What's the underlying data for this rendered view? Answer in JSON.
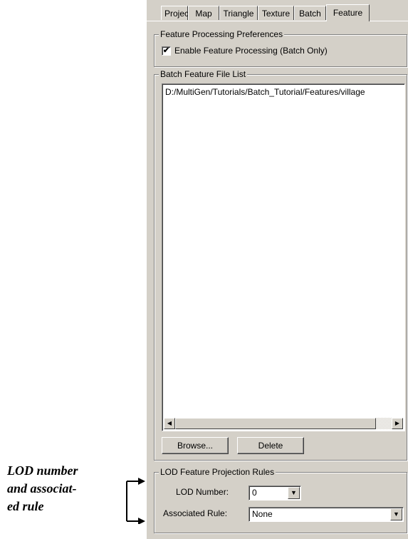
{
  "tabs": [
    {
      "label": "Project",
      "active": false
    },
    {
      "label": "Map",
      "active": false
    },
    {
      "label": "Triangle",
      "active": false
    },
    {
      "label": "Texture",
      "active": false
    },
    {
      "label": "Batch",
      "active": false
    },
    {
      "label": "Feature",
      "active": true
    }
  ],
  "prefs": {
    "title": "Feature Processing Preferences",
    "enable_label": "Enable Feature Processing (Batch Only)",
    "enable_checked": true,
    "check_glyph": "✔"
  },
  "file_list": {
    "title": "Batch Feature File List",
    "items": [
      "D:/MultiGen/Tutorials/Batch_Tutorial/Features/village"
    ],
    "browse_label": "Browse...",
    "delete_label": "Delete"
  },
  "lod": {
    "title": "LOD Feature Projection Rules",
    "number_label": "LOD Number:",
    "number_value": "0",
    "rule_label": "Associated Rule:",
    "rule_value": "None"
  },
  "caption": {
    "line1": "LOD  number",
    "line2": "and associat-",
    "line3": "ed rule"
  },
  "icons": {
    "scroll_left": "◀",
    "scroll_right": "▶",
    "dropdown": "▼"
  },
  "colors": {
    "panel_bg": "#d4d0c8",
    "field_bg": "#ffffff"
  }
}
